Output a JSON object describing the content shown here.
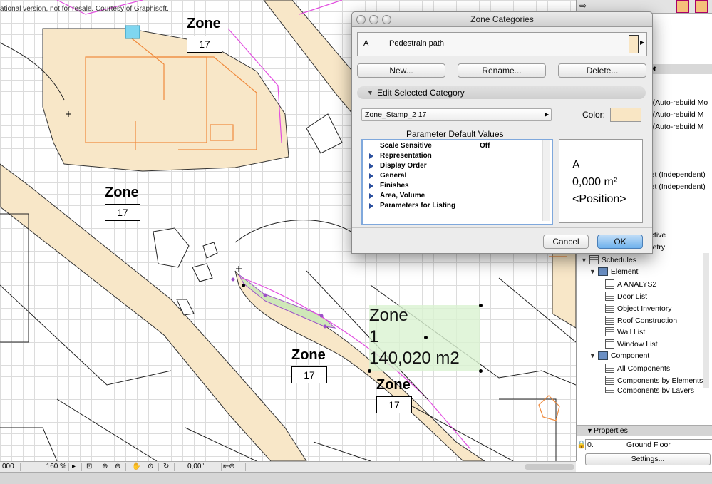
{
  "canvas": {
    "watermark": "ational version, not for resale. Courtesy of Graphisoft.",
    "zone_stamps": [
      {
        "title": "Zone",
        "number": "17"
      },
      {
        "title": "Zone",
        "number": "17"
      },
      {
        "title": "Zone",
        "number": "17"
      },
      {
        "title": "Zone",
        "number": "17"
      }
    ],
    "selected_zone": {
      "title": "Zone",
      "number": "1",
      "area": "140,020 m2"
    },
    "colors": {
      "path_fill": "#f8e7c8",
      "zone_fill": "#d9f2d1",
      "wall": "#f08a3c",
      "magenta": "#e24de0"
    }
  },
  "bottom_bar": {
    "coord": "000",
    "zoom": "160 %",
    "angle": "0,00°"
  },
  "right_panel": {
    "header": "oor",
    "partial_items": [
      "on (Auto-rebuild Mo",
      "on (Auto-rebuild M",
      "on (Auto-rebuild M",
      "ns",
      "heet (Independent)",
      "heet (Independent)",
      "pective",
      "ometry"
    ],
    "tree": {
      "schedules": "Schedules",
      "element": "Element",
      "element_items": [
        "A ANALYS2",
        "Door List",
        "Object Inventory",
        "Roof Construction",
        "Wall List",
        "Window List"
      ],
      "component": "Component",
      "component_items": [
        "All Components",
        "Components by Elements",
        "Components by Layers"
      ]
    },
    "properties": {
      "title": "Properties",
      "id_value": "0.",
      "layer_value": "Ground Floor",
      "settings_button": "Settings..."
    }
  },
  "dialog": {
    "title": "Zone Categories",
    "category": {
      "code": "A",
      "name": "Pedestrain path",
      "color": "#f9e6c4"
    },
    "buttons": {
      "new": "New...",
      "rename": "Rename...",
      "delete": "Delete...",
      "cancel": "Cancel",
      "ok": "OK"
    },
    "edit_section": "Edit Selected Category",
    "stamp_select": "Zone_Stamp_2 17",
    "color_label": "Color:",
    "param_heading": "Parameter Default Values",
    "params": [
      {
        "label": "Scale Sensitive",
        "value": "Off",
        "expandable": false
      },
      {
        "label": "Representation",
        "expandable": true
      },
      {
        "label": "Display Order",
        "expandable": true
      },
      {
        "label": "General",
        "expandable": true
      },
      {
        "label": "Finishes",
        "expandable": true
      },
      {
        "label": "Area, Volume",
        "expandable": true
      },
      {
        "label": "Parameters for Listing",
        "expandable": true
      }
    ],
    "preview": {
      "line1": "A",
      "line2": "0,000 m²",
      "line3": "<Position>"
    }
  }
}
